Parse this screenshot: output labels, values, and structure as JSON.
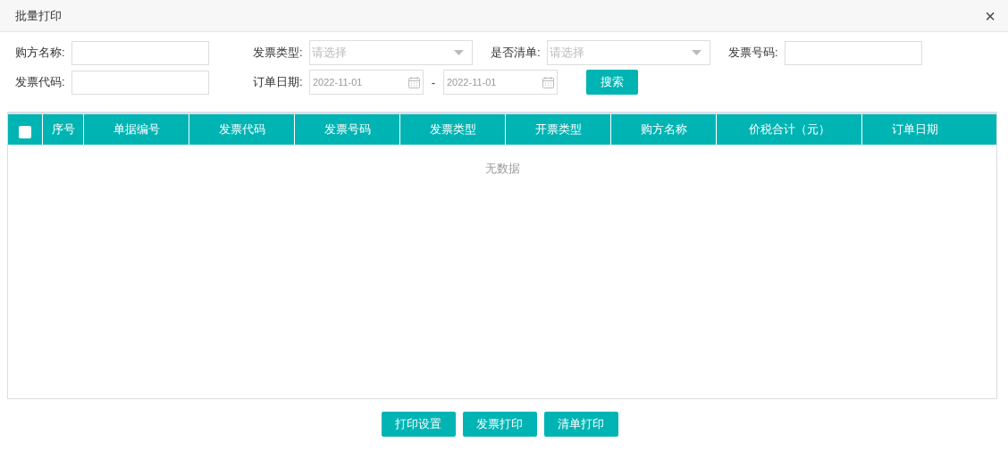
{
  "dialog": {
    "title": "批量打印",
    "close": "×"
  },
  "filter_rows": [
    [
      {
        "kind": "text",
        "label": "购方名称:"
      },
      {
        "kind": "select",
        "label": "发票类型:",
        "placeholder": "请选择"
      },
      {
        "kind": "select",
        "label": "是否清单:",
        "placeholder": "请选择"
      },
      {
        "kind": "text",
        "label": "发票号码:"
      }
    ],
    [
      {
        "kind": "text",
        "label": "发票代码:"
      },
      {
        "kind": "daterange",
        "label": "订单日期:",
        "from": "2022-11-01",
        "separator": "-",
        "to": "2022-11-01"
      },
      {
        "kind": "button",
        "label": "搜索"
      }
    ]
  ],
  "table": {
    "select_all_checked": false,
    "columns": [
      "序号",
      "单据编号",
      "发票代码",
      "发票号码",
      "发票类型",
      "开票类型",
      "购方名称",
      "价税合计（元）",
      "订单日期"
    ],
    "empty_text": "无数据"
  },
  "buttons": [
    "打印设置",
    "发票打印",
    "清单打印"
  ]
}
